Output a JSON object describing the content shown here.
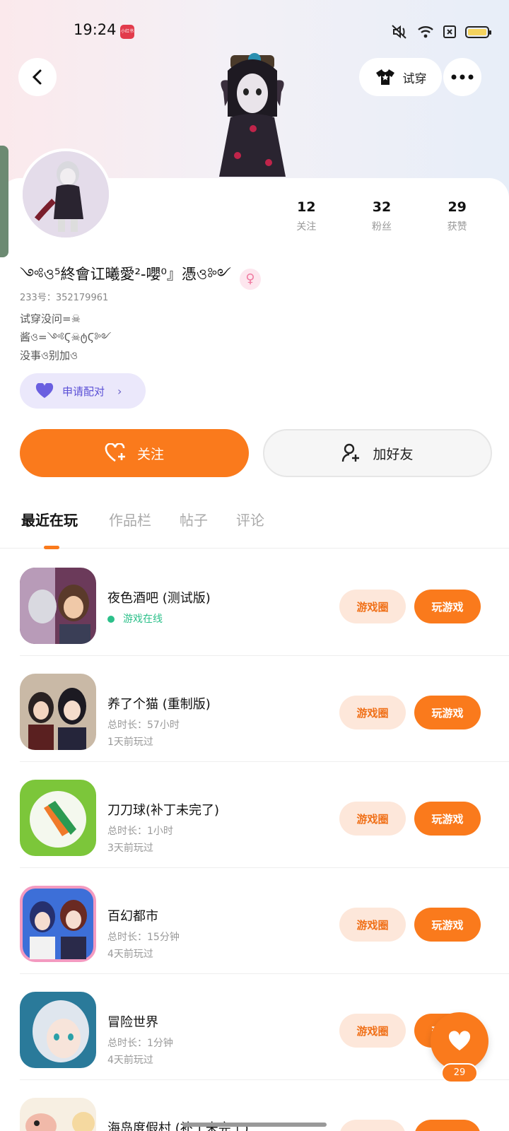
{
  "status_bar": {
    "time": "19:24",
    "app_badge": "小红书"
  },
  "header": {
    "tryon_label": "试穿"
  },
  "profile": {
    "nickname": "༺ও⁵終會讧曦愛²-嚶⁰』憑ও༻",
    "user_id": "233号：352179961",
    "bio_lines": [
      "试穿没问=☠",
      "酱ও=༺Ϛ☠ტϚ༻",
      "没事ও别加ও"
    ],
    "pair_label": "申请配对"
  },
  "stats": [
    {
      "value": "12",
      "label": "关注"
    },
    {
      "value": "32",
      "label": "粉丝"
    },
    {
      "value": "29",
      "label": "获赞"
    }
  ],
  "actions": {
    "follow_label": "关注",
    "friend_label": "加好友"
  },
  "tabs": [
    "最近在玩",
    "作品栏",
    "帖子",
    "评论"
  ],
  "games": [
    {
      "title": "夜色酒吧 (测试版)",
      "meta1": "游戏在线",
      "meta2": "",
      "online": true,
      "circle": "游戏圈",
      "play": "玩游戏"
    },
    {
      "title": "养了个猫 (重制版)",
      "meta1": "总时长：57小时",
      "meta2": "1天前玩过",
      "online": false,
      "circle": "游戏圈",
      "play": "玩游戏"
    },
    {
      "title": "刀刀球(补丁未完了)",
      "meta1": "总时长：1小时",
      "meta2": "3天前玩过",
      "online": false,
      "circle": "游戏圈",
      "play": "玩游戏"
    },
    {
      "title": "百幻都市",
      "meta1": "总时长：15分钟",
      "meta2": "4天前玩过",
      "online": false,
      "circle": "游戏圈",
      "play": "玩游戏"
    },
    {
      "title": "冒险世界",
      "meta1": "总时长：1分钟",
      "meta2": "4天前玩过",
      "online": false,
      "circle": "游戏圈",
      "play": "玩游戏"
    },
    {
      "title": "海岛度假村 (补丁未完了)",
      "meta1": "",
      "meta2": "",
      "online": false,
      "circle": "游戏圈",
      "play": "玩游戏"
    }
  ],
  "fab": {
    "count": "29"
  },
  "colors": {
    "accent": "#fa7a1c",
    "accent_light": "#fde7da",
    "pair_bg": "#ebe8fb",
    "online_green": "#2cc08a"
  }
}
